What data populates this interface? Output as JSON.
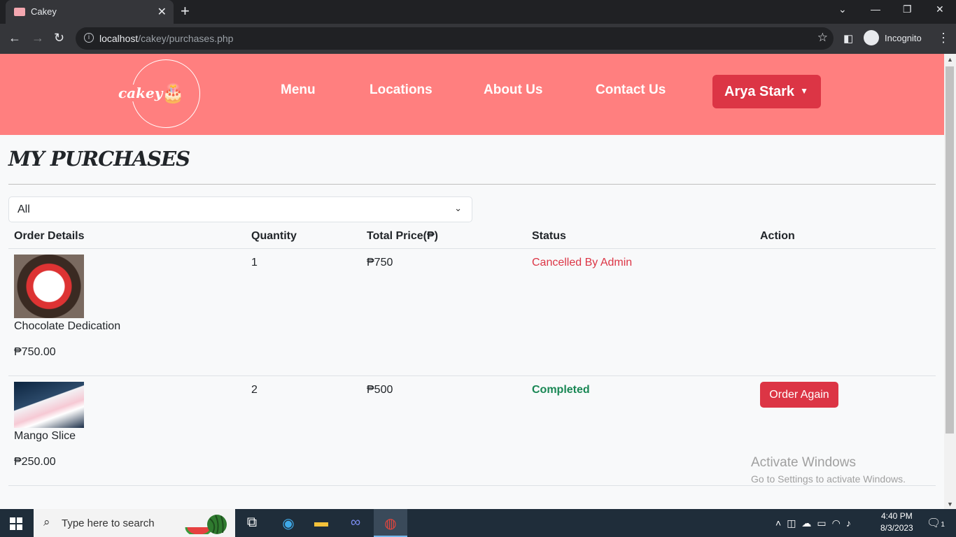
{
  "browser": {
    "tab_title": "Cakey",
    "url_host": "localhost",
    "url_path": "/cakey/purchases.php",
    "incognito_label": "Incognito"
  },
  "nav": {
    "logo_text": "cakey",
    "links": [
      "Menu",
      "Locations",
      "About Us",
      "Contact Us"
    ],
    "user": "Arya Stark"
  },
  "page": {
    "heading": "MY PURCHASES",
    "filter_value": "All",
    "columns": [
      "Order Details",
      "Quantity",
      "Total Price(₱)",
      "Status",
      "Action"
    ]
  },
  "orders": [
    {
      "name": "Chocolate Dedication",
      "unit_price": "₱750.00",
      "quantity": "1",
      "total": "₱750",
      "status": "Cancelled By Admin",
      "status_color": "#dc3545",
      "action": ""
    },
    {
      "name": "Mango Slice",
      "unit_price": "₱250.00",
      "quantity": "2",
      "total": "₱500",
      "status": "Completed",
      "status_color": "#198754",
      "action": "Order Again"
    }
  ],
  "watermark": {
    "line1": "Activate Windows",
    "line2": "Go to Settings to activate Windows."
  },
  "taskbar": {
    "search_placeholder": "Type here to search",
    "time": "4:40 PM",
    "date": "8/3/2023",
    "notification_count": "1"
  },
  "colors": {
    "navbar": "#ff7f7f",
    "accent": "#dc3545"
  }
}
